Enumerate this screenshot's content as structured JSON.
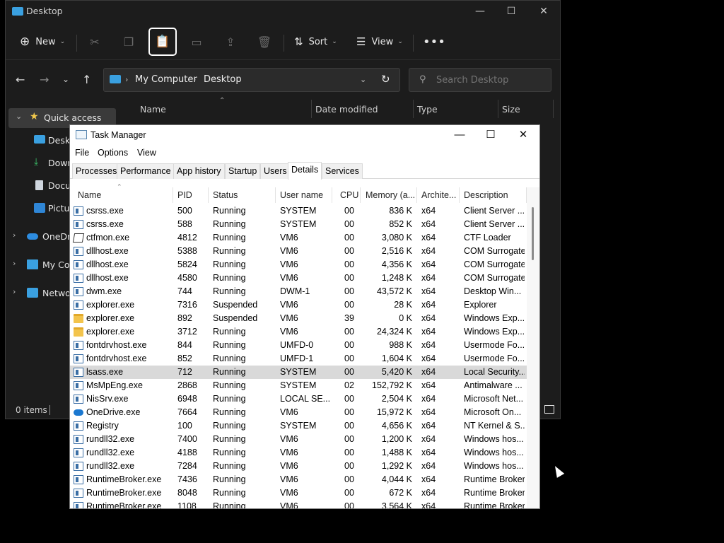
{
  "explorer": {
    "title": "Desktop",
    "toolbar": {
      "new_label": "New",
      "sort_label": "Sort",
      "view_label": "View"
    },
    "address": {
      "crumb1": "My Computer",
      "crumb2": "Desktop"
    },
    "search": {
      "placeholder": "Search Desktop"
    },
    "nav": [
      {
        "label": "Quick access"
      },
      {
        "label": "Deskto"
      },
      {
        "label": "Down"
      },
      {
        "label": "Docur"
      },
      {
        "label": "Pictur"
      },
      {
        "label": "OneDriv"
      },
      {
        "label": "My Cor"
      },
      {
        "label": "Networ"
      }
    ],
    "columns": {
      "name": "Name",
      "date": "Date modified",
      "type": "Type",
      "size": "Size"
    },
    "status": "0 items"
  },
  "taskmanager": {
    "title": "Task Manager",
    "menu": [
      "File",
      "Options",
      "View"
    ],
    "tabs": [
      "Processes",
      "Performance",
      "App history",
      "Startup",
      "Users",
      "Details",
      "Services"
    ],
    "active_tab": "Details",
    "columns": [
      "Name",
      "PID",
      "Status",
      "User name",
      "CPU",
      "Memory (a...",
      "Archite...",
      "Description"
    ],
    "rows": [
      {
        "icon": "app",
        "name": "csrss.exe",
        "pid": "500",
        "status": "Running",
        "user": "SYSTEM",
        "cpu": "00",
        "mem": "836 K",
        "arch": "x64",
        "desc": "Client Server ..."
      },
      {
        "icon": "app",
        "name": "csrss.exe",
        "pid": "588",
        "status": "Running",
        "user": "SYSTEM",
        "cpu": "00",
        "mem": "852 K",
        "arch": "x64",
        "desc": "Client Server ..."
      },
      {
        "icon": "pen",
        "name": "ctfmon.exe",
        "pid": "4812",
        "status": "Running",
        "user": "VM6",
        "cpu": "00",
        "mem": "3,080 K",
        "arch": "x64",
        "desc": "CTF Loader"
      },
      {
        "icon": "app",
        "name": "dllhost.exe",
        "pid": "5388",
        "status": "Running",
        "user": "VM6",
        "cpu": "00",
        "mem": "2,516 K",
        "arch": "x64",
        "desc": "COM Surrogate"
      },
      {
        "icon": "app",
        "name": "dllhost.exe",
        "pid": "5824",
        "status": "Running",
        "user": "VM6",
        "cpu": "00",
        "mem": "4,356 K",
        "arch": "x64",
        "desc": "COM Surrogate"
      },
      {
        "icon": "app",
        "name": "dllhost.exe",
        "pid": "4580",
        "status": "Running",
        "user": "VM6",
        "cpu": "00",
        "mem": "1,248 K",
        "arch": "x64",
        "desc": "COM Surrogate"
      },
      {
        "icon": "app",
        "name": "dwm.exe",
        "pid": "744",
        "status": "Running",
        "user": "DWM-1",
        "cpu": "00",
        "mem": "43,572 K",
        "arch": "x64",
        "desc": "Desktop Win..."
      },
      {
        "icon": "app",
        "name": "explorer.exe",
        "pid": "7316",
        "status": "Suspended",
        "user": "VM6",
        "cpu": "00",
        "mem": "28 K",
        "arch": "x64",
        "desc": "Explorer"
      },
      {
        "icon": "folder",
        "name": "explorer.exe",
        "pid": "892",
        "status": "Suspended",
        "user": "VM6",
        "cpu": "39",
        "mem": "0 K",
        "arch": "x64",
        "desc": "Windows Exp..."
      },
      {
        "icon": "folder",
        "name": "explorer.exe",
        "pid": "3712",
        "status": "Running",
        "user": "VM6",
        "cpu": "00",
        "mem": "24,324 K",
        "arch": "x64",
        "desc": "Windows Exp..."
      },
      {
        "icon": "app",
        "name": "fontdrvhost.exe",
        "pid": "844",
        "status": "Running",
        "user": "UMFD-0",
        "cpu": "00",
        "mem": "988 K",
        "arch": "x64",
        "desc": "Usermode Fo..."
      },
      {
        "icon": "app",
        "name": "fontdrvhost.exe",
        "pid": "852",
        "status": "Running",
        "user": "UMFD-1",
        "cpu": "00",
        "mem": "1,604 K",
        "arch": "x64",
        "desc": "Usermode Fo..."
      },
      {
        "icon": "app",
        "name": "lsass.exe",
        "pid": "712",
        "status": "Running",
        "user": "SYSTEM",
        "cpu": "00",
        "mem": "5,420 K",
        "arch": "x64",
        "desc": "Local Security...",
        "selected": true
      },
      {
        "icon": "app",
        "name": "MsMpEng.exe",
        "pid": "2868",
        "status": "Running",
        "user": "SYSTEM",
        "cpu": "02",
        "mem": "152,792 K",
        "arch": "x64",
        "desc": "Antimalware ..."
      },
      {
        "icon": "app",
        "name": "NisSrv.exe",
        "pid": "6948",
        "status": "Running",
        "user": "LOCAL SE...",
        "cpu": "00",
        "mem": "2,504 K",
        "arch": "x64",
        "desc": "Microsoft Net..."
      },
      {
        "icon": "cloud",
        "name": "OneDrive.exe",
        "pid": "7664",
        "status": "Running",
        "user": "VM6",
        "cpu": "00",
        "mem": "15,972 K",
        "arch": "x64",
        "desc": "Microsoft On..."
      },
      {
        "icon": "app",
        "name": "Registry",
        "pid": "100",
        "status": "Running",
        "user": "SYSTEM",
        "cpu": "00",
        "mem": "4,656 K",
        "arch": "x64",
        "desc": "NT Kernel & S..."
      },
      {
        "icon": "app",
        "name": "rundll32.exe",
        "pid": "7400",
        "status": "Running",
        "user": "VM6",
        "cpu": "00",
        "mem": "1,200 K",
        "arch": "x64",
        "desc": "Windows hos..."
      },
      {
        "icon": "app",
        "name": "rundll32.exe",
        "pid": "4188",
        "status": "Running",
        "user": "VM6",
        "cpu": "00",
        "mem": "1,488 K",
        "arch": "x64",
        "desc": "Windows hos..."
      },
      {
        "icon": "app",
        "name": "rundll32.exe",
        "pid": "7284",
        "status": "Running",
        "user": "VM6",
        "cpu": "00",
        "mem": "1,292 K",
        "arch": "x64",
        "desc": "Windows hos..."
      },
      {
        "icon": "app",
        "name": "RuntimeBroker.exe",
        "pid": "7436",
        "status": "Running",
        "user": "VM6",
        "cpu": "00",
        "mem": "4,044 K",
        "arch": "x64",
        "desc": "Runtime Broker"
      },
      {
        "icon": "app",
        "name": "RuntimeBroker.exe",
        "pid": "8048",
        "status": "Running",
        "user": "VM6",
        "cpu": "00",
        "mem": "672 K",
        "arch": "x64",
        "desc": "Runtime Broker"
      },
      {
        "icon": "app",
        "name": "RuntimeBroker.exe",
        "pid": "1108",
        "status": "Running",
        "user": "VM6",
        "cpu": "00",
        "mem": "3,564 K",
        "arch": "x64",
        "desc": "Runtime Broker"
      }
    ]
  }
}
